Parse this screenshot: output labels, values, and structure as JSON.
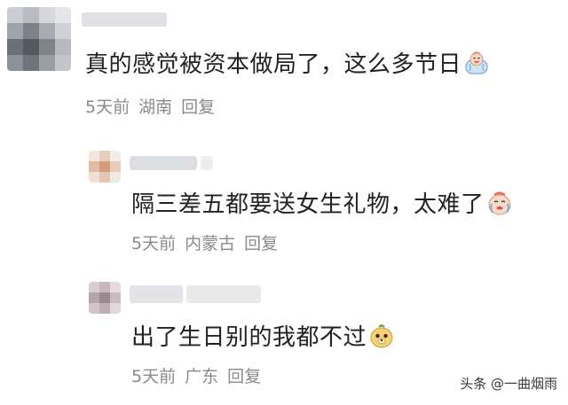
{
  "comments": [
    {
      "text": "真的感觉被资本做局了，这么多节日",
      "emoji": "crying-laugh-emoji",
      "meta": {
        "time": "5天前",
        "location": "湖南",
        "reply": "回复"
      }
    },
    {
      "text": "隔三差五都要送女生礼物，太难了",
      "emoji": "crying-face-emoji",
      "meta": {
        "time": "5天前",
        "location": "内蒙古",
        "reply": "回复"
      }
    },
    {
      "text": "出了生日别的我都不过",
      "emoji": "smug-face-emoji",
      "meta": {
        "time": "5天前",
        "location": "广东",
        "reply": "回复"
      }
    }
  ],
  "watermark": "头条 @一曲烟雨",
  "colors": {
    "text": "#222222",
    "meta": "#8a8a8a",
    "background": "#ffffff"
  }
}
